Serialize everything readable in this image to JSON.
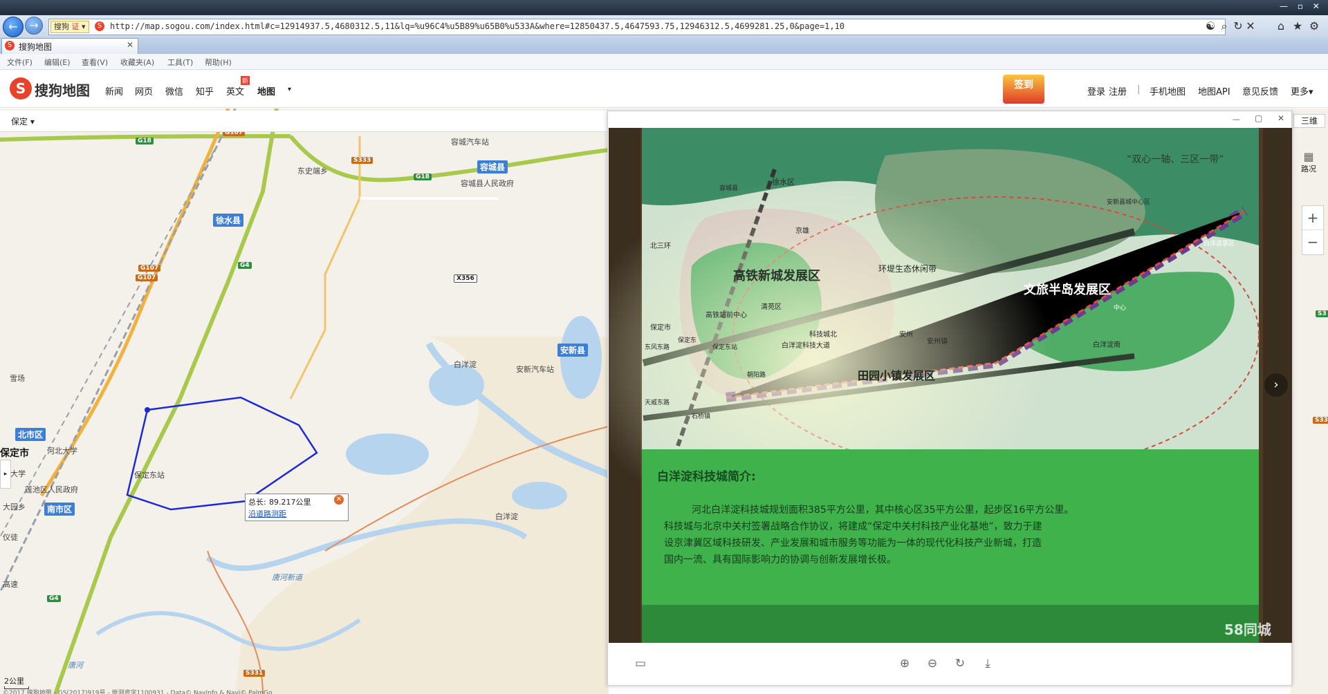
{
  "browser": {
    "search_tag": "搜狗",
    "search_tag2": "证",
    "url": "http://map.sogou.com/index.html#c=12914937.5,4680312.5,11&lq=%u96C4%u5B89%u65B0%u533A&where=12850437.5,4647593.75,12946312.5,4699281.25,0&page=1,10",
    "tab_title": "搜狗地图",
    "menus": [
      "文件(F)",
      "编辑(E)",
      "查看(V)",
      "收藏夹(A)",
      "工具(T)",
      "帮助(H)"
    ]
  },
  "site": {
    "logo_text": "搜狗地图",
    "nav": [
      "新闻",
      "网页",
      "微信",
      "知乎",
      "英文",
      "地图"
    ],
    "new_badge": "新",
    "signin_badge": "签到",
    "right_nav": [
      "登录",
      "注册",
      "手机地图",
      "地图API",
      "意见反馈",
      "更多"
    ],
    "separator": "|"
  },
  "map": {
    "city": "保定",
    "three_d": "三维",
    "traffic": "路况",
    "county_labels": [
      "徐水县",
      "容城县",
      "安新县",
      "北市区",
      "南市区"
    ],
    "city_label": "保定市",
    "places": [
      "东史端乡",
      "容城汽车站",
      "容城县人民政府",
      "白洋淀",
      "安新汽车站",
      "保定东站",
      "河北大学",
      "莲池区人民政府",
      "白洋淀",
      "唐河新道",
      "唐河",
      "雪场",
      "北大学",
      "大园乡",
      "仪徒",
      "高速"
    ],
    "shields": [
      "G18",
      "G107",
      "S333",
      "G18",
      "G107",
      "G107",
      "G4",
      "X356",
      "G4",
      "S331",
      "S3",
      "S334"
    ],
    "scale": "2公里",
    "copyright": "©2017 搜狗地图 - GS(2017)919号 - 甲测资字1100931 - Data© NavInfo & Navi© PalmGo",
    "measure": {
      "label": "总长:",
      "value": "89.217公里",
      "link": "沿道路测距"
    }
  },
  "photo": {
    "title_tag": "“双心一轴、三区一带”",
    "zones": [
      "高铁新城发展区",
      "文旅半岛发展区",
      "田园小镇发展区",
      "环堤生态休闲带"
    ],
    "small_labels": [
      "徐水区",
      "北三环",
      "京雄",
      "保定市",
      "东风东路",
      "天威东路",
      "高铁站前中心",
      "清苑区",
      "科技城北",
      "白洋淀科技大道",
      "安州",
      "安州镇",
      "白洋淀南",
      "容城县",
      "安新县城中心区",
      "保定东",
      "保定东站",
      "朝阳路",
      "石桥镇",
      "白洋淀景区",
      "中心"
    ],
    "intro_title": "白洋淀科技城简介:",
    "intro_lines": [
      "河北白洋淀科技城规划面积385平方公里，其中核心区35平方公里，起步区16平方公里。",
      "科技城与北京中关村签署战略合作协议，将建成“保定中关村科技产业化基地”，致力于建",
      "设京津冀区域科技研发、产业发展和城市服务等功能为一体的现代化科技产业新城，打造",
      "国内一流、具有国际影响力的协调与创新发展增长极。"
    ],
    "watermark": "58同城"
  }
}
